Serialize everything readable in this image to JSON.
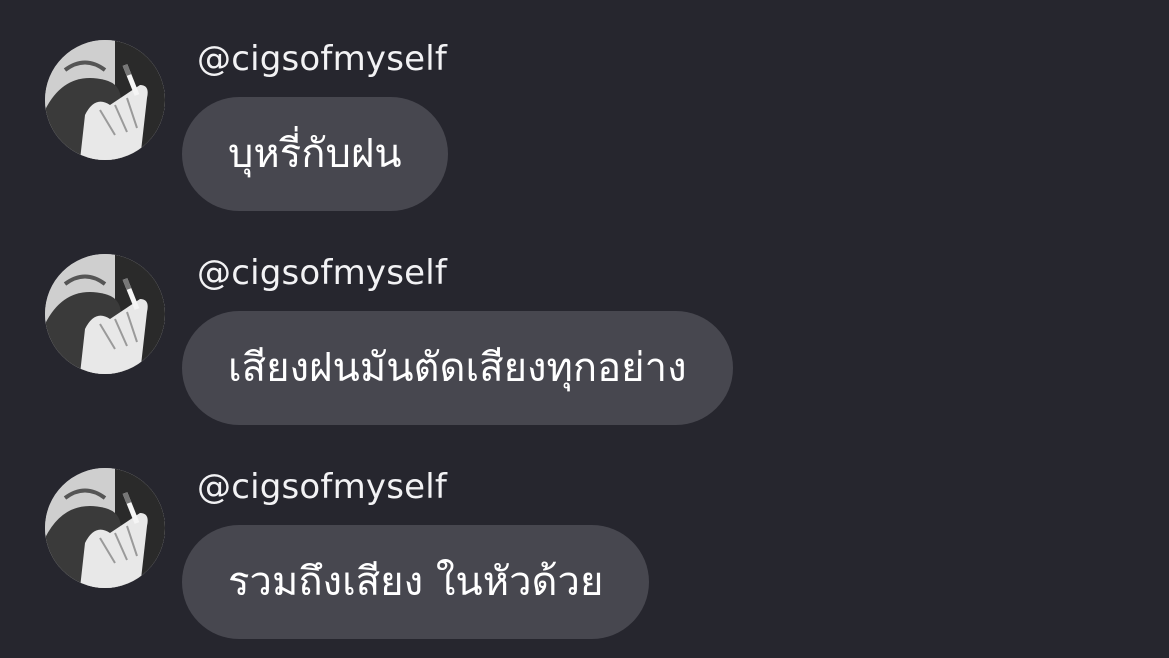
{
  "messages": [
    {
      "username": "@cigsofmyself",
      "text": "บุหรี่กับฝน",
      "avatar_icon": "hand-holding-cigarette-photo"
    },
    {
      "username": "@cigsofmyself",
      "text": "เสียงฝนมันตัดเสียงทุกอย่าง",
      "avatar_icon": "hand-holding-cigarette-photo"
    },
    {
      "username": "@cigsofmyself",
      "text": "รวมถึงเสียง ในหัวด้วย",
      "avatar_icon": "hand-holding-cigarette-photo"
    }
  ],
  "colors": {
    "background": "#26262e",
    "bubble": "#47474f",
    "text": "#ffffff",
    "username": "#f2f2f4"
  }
}
